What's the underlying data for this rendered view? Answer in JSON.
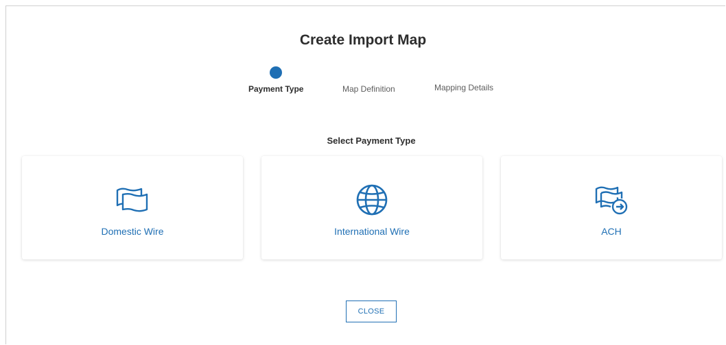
{
  "dialog": {
    "title": "Create Import Map",
    "steps": [
      {
        "label": "Payment Type",
        "active": true
      },
      {
        "label": "Map Definition",
        "active": false
      },
      {
        "label": "Mapping Details",
        "active": false
      }
    ],
    "section_label": "Select Payment Type",
    "payment_types": [
      {
        "label": "Domestic Wire",
        "icon": "banknotes-icon"
      },
      {
        "label": "International Wire",
        "icon": "globe-icon"
      },
      {
        "label": "ACH",
        "icon": "banknotes-arrow-icon"
      }
    ],
    "close_label": "CLOSE",
    "colors": {
      "accent": "#1f6fb4",
      "text": "#2d2d2d"
    }
  }
}
